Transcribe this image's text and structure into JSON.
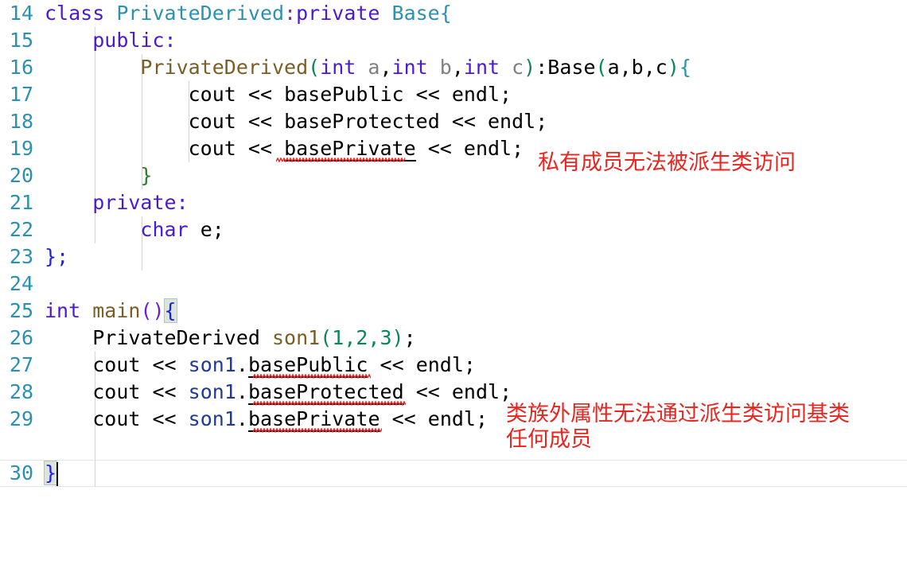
{
  "editor": {
    "language": "cpp",
    "background": "#ffffff",
    "line_number_color": "#2b91af",
    "current_line": 30,
    "font_size_px": 25,
    "line_height_px": 34
  },
  "lines": [
    {
      "n": "14",
      "text": "class PrivateDerived:private Base{"
    },
    {
      "n": "15",
      "text": "    public:"
    },
    {
      "n": "16",
      "text": "        PrivateDerived(int a,int b,int c):Base(a,b,c){"
    },
    {
      "n": "17",
      "text": "            cout << basePublic << endl;"
    },
    {
      "n": "18",
      "text": "            cout << baseProtected << endl;"
    },
    {
      "n": "19",
      "text": "            cout << basePrivate << endl;"
    },
    {
      "n": "20",
      "text": "        }"
    },
    {
      "n": "21",
      "text": "    private:"
    },
    {
      "n": "22",
      "text": "        char e;"
    },
    {
      "n": "23",
      "text": "};"
    },
    {
      "n": "24",
      "text": ""
    },
    {
      "n": "25",
      "text": "int main(){"
    },
    {
      "n": "26",
      "text": "    PrivateDerived son1(1,2,3);"
    },
    {
      "n": "27",
      "text": "    cout << son1.basePublic << endl;"
    },
    {
      "n": "28",
      "text": "    cout << son1.baseProtected << endl;"
    },
    {
      "n": "29",
      "text": "    cout << son1.basePrivate << endl;"
    },
    {
      "n": "30",
      "text": "}"
    }
  ],
  "tokens": {
    "kw_class": "class",
    "kw_public": "public:",
    "kw_private": "private:",
    "kw_private_inline": "private",
    "kw_int": "int",
    "kw_char": "char",
    "type_private_derived": "PrivateDerived",
    "type_base": "Base",
    "id_cout": "cout",
    "id_endl": "endl",
    "id_base_public": "basePublic",
    "id_base_protected": "baseProtected",
    "id_base_private": "basePrivate",
    "id_son1": "son1",
    "id_main": "main",
    "id_e": "e",
    "op_shift": "<<",
    "op_colon": ":",
    "op_semi": ";",
    "op_dot": ".",
    "args_abc": "a,b,c",
    "args_123": "1,2,3"
  },
  "annotations": [
    {
      "id": "anno-private-member",
      "text": "私有成员无法被派生类访问",
      "color": "#e8251f",
      "target_line": "19"
    },
    {
      "id": "anno-outside-class",
      "line1": "类族外属性无法通过派生类访问基类",
      "line2": "任何成员",
      "color": "#e8251f",
      "target_line": "28"
    }
  ],
  "diagnostics": {
    "squiggle_color": "#ee2222",
    "errors": [
      {
        "line": "19",
        "symbol": "basePrivate"
      },
      {
        "line": "27",
        "symbol": "basePublic"
      },
      {
        "line": "28",
        "symbol": "baseProtected"
      },
      {
        "line": "29",
        "symbol": "basePrivate"
      }
    ]
  },
  "bracket_match": {
    "open_line": "25",
    "open_char": "{",
    "close_line": "30",
    "close_char": "}",
    "highlight_color": "#dbe4dd"
  }
}
